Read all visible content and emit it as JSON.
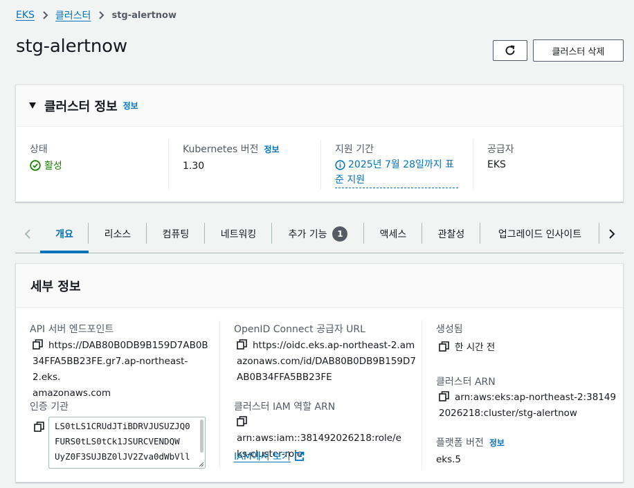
{
  "breadcrumb": {
    "items": [
      "EKS",
      "클러스터"
    ],
    "current": "stg-alertnow"
  },
  "page": {
    "title": "stg-alertnow",
    "delete_label": "클러스터 삭제"
  },
  "cluster_info": {
    "title": "클러스터 정보",
    "info_link": "정보",
    "status_label": "상태",
    "status_value": "활성",
    "k8s_label": "Kubernetes 버전",
    "k8s_info": "정보",
    "k8s_value": "1.30",
    "support_label": "지원 기간",
    "support_line1": "2025년 7월 28일까지 표",
    "support_line2": "준 지원",
    "provider_label": "공급자",
    "provider_value": "EKS"
  },
  "tabs": {
    "items": [
      "개요",
      "리소스",
      "컴퓨팅",
      "네트워킹",
      "추가 기능",
      "액세스",
      "관찰성",
      "업그레이드 인사이트"
    ],
    "badge": "1",
    "active": "개요"
  },
  "details": {
    "title": "세부 정보",
    "api_label": "API 서버 엔드포인트",
    "api_lines": [
      "https://DAB80B0DB9B159D7AB0B",
      "34FFA5BB23FE.gr7.ap-northeast-2.eks.",
      "amazonaws.com"
    ],
    "auth_label": "인증 기관",
    "auth_lines": [
      "LS0tLS1CRUdJTiBDRVJUSUZJQ0",
      "FURS0tLS0tCk1JSURCVENDQW",
      "UyZ0F3SUJBZ0lJV2Zva0dWbVll"
    ],
    "oidc_label": "OpenID Connect 공급자 URL",
    "oidc_lines": [
      "https://oidc.eks.ap-northeast-2.am",
      "azonaws.com/id/DAB80B0DB9B159D7",
      "AB0B34FFA5BB23FE"
    ],
    "iam_label": "클러스터 IAM 역할 ARN",
    "iam_lines": [
      "arn:aws:iam::381492026218:role/e",
      "ks-cluster-role"
    ],
    "iam_link": "IAM에서 보기",
    "created_label": "생성됨",
    "created_value": "한 시간 전",
    "arn_label": "클러스터 ARN",
    "arn_lines": [
      "arn:aws:eks:ap-northeast-2:38149",
      "2026218:cluster/stg-alertnow"
    ],
    "platform_label": "플랫폼 버전",
    "platform_info": "정보",
    "platform_value": "eks.5"
  }
}
